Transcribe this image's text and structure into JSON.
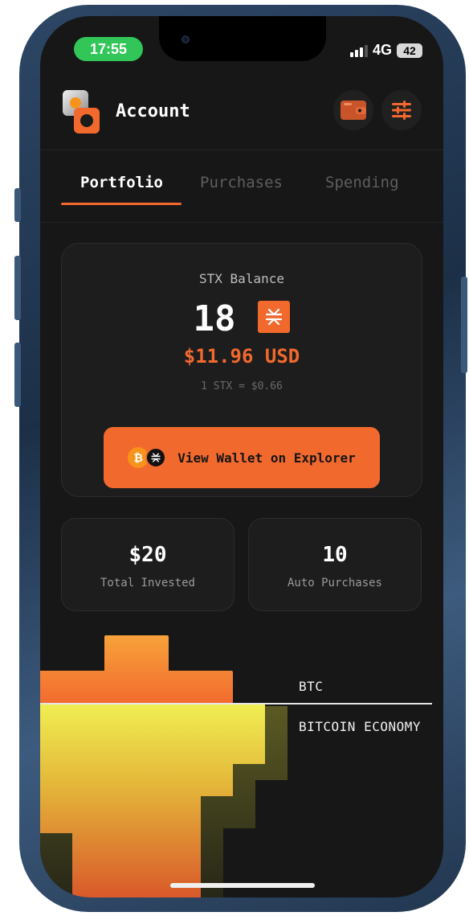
{
  "status_bar": {
    "time": "17:55",
    "network": "4G",
    "battery": "42"
  },
  "header": {
    "title": "Account",
    "wallet_icon": "wallet-icon",
    "settings_icon": "sliders-icon"
  },
  "tabs": [
    {
      "label": "Portfolio",
      "active": true
    },
    {
      "label": "Purchases",
      "active": false
    },
    {
      "label": "Spending",
      "active": false
    }
  ],
  "balance": {
    "label": "STX Balance",
    "amount": "18",
    "usd": "$11.96 USD",
    "rate": "1 STX = $0.66",
    "explorer_button": "View Wallet on Explorer"
  },
  "stats": {
    "total_invested": {
      "value": "$20",
      "label": "Total Invested"
    },
    "auto_purchases": {
      "value": "10",
      "label": "Auto Purchases"
    }
  },
  "illustration": {
    "label_top": "BTC",
    "label_bottom": "BITCOIN ECONOMY"
  },
  "colors": {
    "accent": "#f2692e",
    "background": "#171717",
    "card": "#1d1d1d",
    "status_green": "#32c658",
    "btc_orange": "#f7931a"
  }
}
